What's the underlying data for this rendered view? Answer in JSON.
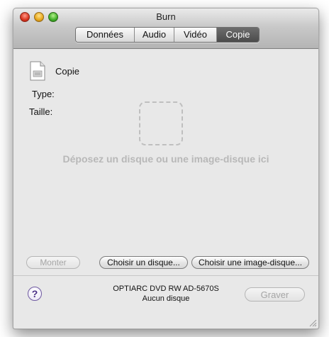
{
  "window": {
    "title": "Burn",
    "tabs": [
      "Données",
      "Audio",
      "Vidéo",
      "Copie"
    ],
    "active_tab": "Copie"
  },
  "source": {
    "name": "Copie",
    "type_label": "Type:",
    "size_label": "Taille:",
    "drop_hint": "Déposez un disque ou une image-disque ici"
  },
  "buttons": {
    "mount": "Monter",
    "choose_disc": "Choisir un disque...",
    "choose_image": "Choisir une image-disque...",
    "burn": "Graver",
    "help": "?"
  },
  "drive": {
    "name": "OPTIARC DVD RW AD-5670S",
    "status": "Aucun disque"
  },
  "icons": {
    "document": "document-icon",
    "help": "help-icon",
    "resize": "resize-grip-icon"
  }
}
